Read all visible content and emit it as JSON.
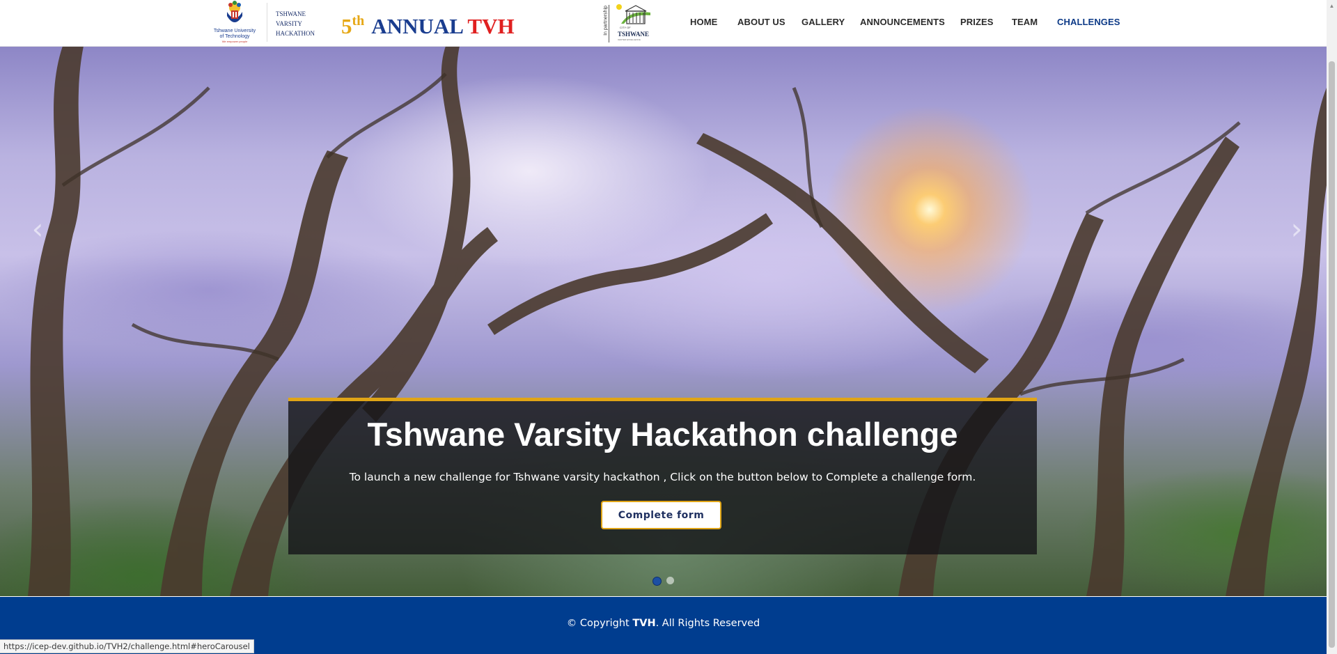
{
  "header": {
    "logo": {
      "university_name": "Tshwane University of Technology",
      "tagline": "We empower people",
      "logo_words": [
        "TSHWANE",
        "VARSITY",
        "HACKATHON"
      ]
    },
    "annual": {
      "number": "5",
      "suffix": "th",
      "word": "ANNUAL",
      "acronym": "TVH"
    },
    "partner": {
      "label": "In partnership",
      "city_small": "CITY OF",
      "city_name": "TSHWANE",
      "city_sub": "IGNITED EXCELLENCE"
    },
    "nav": [
      {
        "label": "HOME",
        "active": false
      },
      {
        "label": "ABOUT US",
        "active": false
      },
      {
        "label": "GALLERY",
        "active": false
      },
      {
        "label": "ANNOUNCEMENTS",
        "active": false
      },
      {
        "label": "PRIZES",
        "active": false
      },
      {
        "label": "TEAM",
        "active": false
      },
      {
        "label": "CHALLENGES",
        "active": true
      }
    ]
  },
  "hero": {
    "prev_icon": "chevron-left-icon",
    "next_icon": "chevron-right-icon",
    "title": "Tshwane Varsity Hackathon challenge",
    "text": "To launch a new challenge for Tshwane varsity hackathon , Click on the button below to Complete a challenge form.",
    "button_label": "Complete form",
    "indicators": {
      "count": 2,
      "active_index": 0
    }
  },
  "footer": {
    "copyright_prefix": "© Copyright ",
    "brand": "TVH",
    "copyright_suffix": ". All Rights Reserved"
  },
  "status_bar": {
    "url": "https://icep-dev.github.io/TVH2/challenge.html#heroCarousel"
  },
  "colors": {
    "accent_gold": "#e0a516",
    "brand_blue": "#1a3d8f",
    "footer_blue": "#003d8f",
    "active_nav": "#0d3a87",
    "tvh_red": "#e02020"
  }
}
